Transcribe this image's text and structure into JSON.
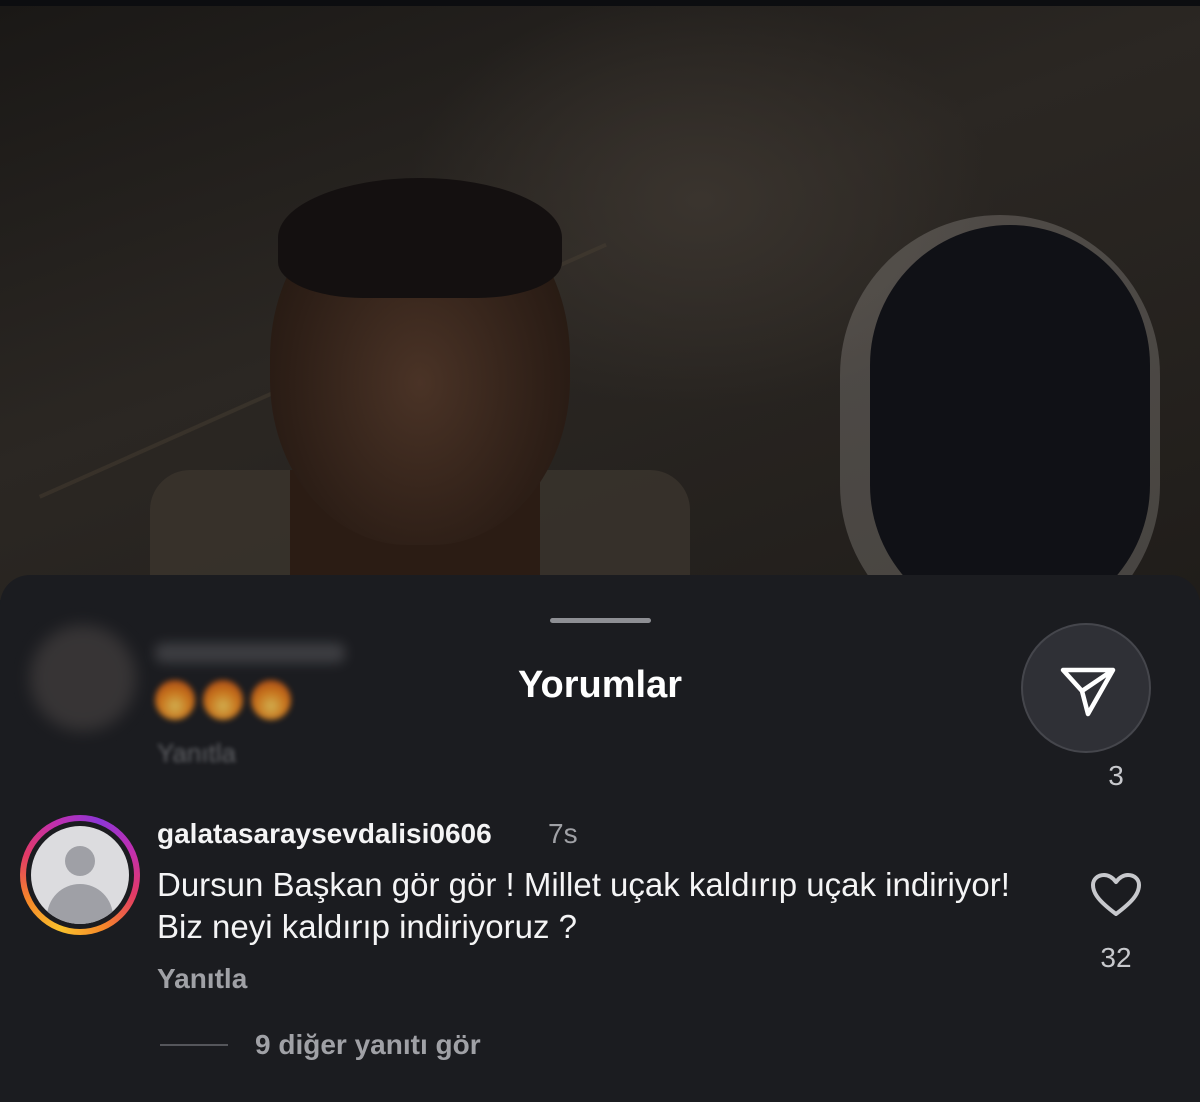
{
  "sheet": {
    "title": "Yorumlar"
  },
  "share": {
    "icon": "send-icon",
    "count": "3"
  },
  "blurred_comment": {
    "reply_label": "Yanıtla"
  },
  "comment": {
    "username": "galatasaraysevdalisi0606",
    "time": "7s",
    "text": "Dursun Başkan gör gör ! Millet uçak kaldırıp uçak indiriyor! Biz neyi kaldırıp indiriyoruz ?",
    "reply_label": "Yanıtla",
    "like_icon": "heart-icon",
    "like_count": "32",
    "view_replies": "9 diğer yanıtı gör"
  },
  "colors": {
    "background": "#1b1c20",
    "text_primary": "#f4f4f5",
    "text_secondary": "#a0a1a6",
    "story_ring": [
      "#f9c12c",
      "#e23a66",
      "#8d36d6"
    ]
  }
}
